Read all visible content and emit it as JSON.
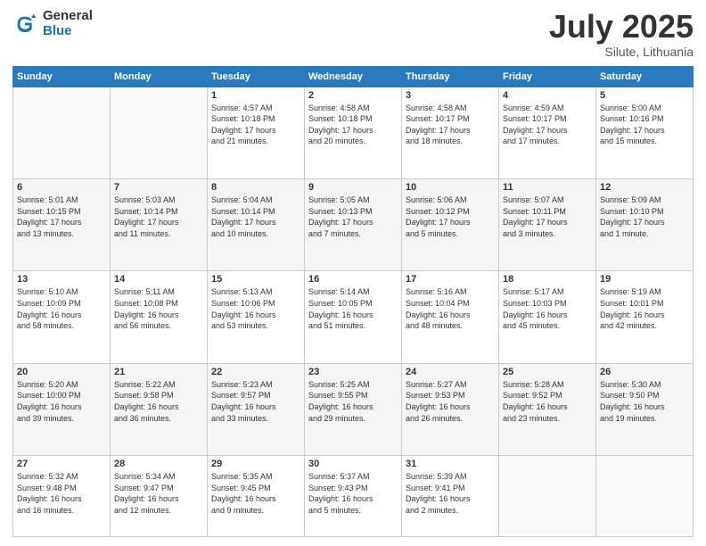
{
  "header": {
    "logo_general": "General",
    "logo_blue": "Blue",
    "month": "July 2025",
    "location": "Silute, Lithuania"
  },
  "days_of_week": [
    "Sunday",
    "Monday",
    "Tuesday",
    "Wednesday",
    "Thursday",
    "Friday",
    "Saturday"
  ],
  "weeks": [
    [
      {
        "num": "",
        "info": ""
      },
      {
        "num": "",
        "info": ""
      },
      {
        "num": "1",
        "info": "Sunrise: 4:57 AM\nSunset: 10:18 PM\nDaylight: 17 hours\nand 21 minutes."
      },
      {
        "num": "2",
        "info": "Sunrise: 4:58 AM\nSunset: 10:18 PM\nDaylight: 17 hours\nand 20 minutes."
      },
      {
        "num": "3",
        "info": "Sunrise: 4:58 AM\nSunset: 10:17 PM\nDaylight: 17 hours\nand 18 minutes."
      },
      {
        "num": "4",
        "info": "Sunrise: 4:59 AM\nSunset: 10:17 PM\nDaylight: 17 hours\nand 17 minutes."
      },
      {
        "num": "5",
        "info": "Sunrise: 5:00 AM\nSunset: 10:16 PM\nDaylight: 17 hours\nand 15 minutes."
      }
    ],
    [
      {
        "num": "6",
        "info": "Sunrise: 5:01 AM\nSunset: 10:15 PM\nDaylight: 17 hours\nand 13 minutes."
      },
      {
        "num": "7",
        "info": "Sunrise: 5:03 AM\nSunset: 10:14 PM\nDaylight: 17 hours\nand 11 minutes."
      },
      {
        "num": "8",
        "info": "Sunrise: 5:04 AM\nSunset: 10:14 PM\nDaylight: 17 hours\nand 10 minutes."
      },
      {
        "num": "9",
        "info": "Sunrise: 5:05 AM\nSunset: 10:13 PM\nDaylight: 17 hours\nand 7 minutes."
      },
      {
        "num": "10",
        "info": "Sunrise: 5:06 AM\nSunset: 10:12 PM\nDaylight: 17 hours\nand 5 minutes."
      },
      {
        "num": "11",
        "info": "Sunrise: 5:07 AM\nSunset: 10:11 PM\nDaylight: 17 hours\nand 3 minutes."
      },
      {
        "num": "12",
        "info": "Sunrise: 5:09 AM\nSunset: 10:10 PM\nDaylight: 17 hours\nand 1 minute."
      }
    ],
    [
      {
        "num": "13",
        "info": "Sunrise: 5:10 AM\nSunset: 10:09 PM\nDaylight: 16 hours\nand 58 minutes."
      },
      {
        "num": "14",
        "info": "Sunrise: 5:11 AM\nSunset: 10:08 PM\nDaylight: 16 hours\nand 56 minutes."
      },
      {
        "num": "15",
        "info": "Sunrise: 5:13 AM\nSunset: 10:06 PM\nDaylight: 16 hours\nand 53 minutes."
      },
      {
        "num": "16",
        "info": "Sunrise: 5:14 AM\nSunset: 10:05 PM\nDaylight: 16 hours\nand 51 minutes."
      },
      {
        "num": "17",
        "info": "Sunrise: 5:16 AM\nSunset: 10:04 PM\nDaylight: 16 hours\nand 48 minutes."
      },
      {
        "num": "18",
        "info": "Sunrise: 5:17 AM\nSunset: 10:03 PM\nDaylight: 16 hours\nand 45 minutes."
      },
      {
        "num": "19",
        "info": "Sunrise: 5:19 AM\nSunset: 10:01 PM\nDaylight: 16 hours\nand 42 minutes."
      }
    ],
    [
      {
        "num": "20",
        "info": "Sunrise: 5:20 AM\nSunset: 10:00 PM\nDaylight: 16 hours\nand 39 minutes."
      },
      {
        "num": "21",
        "info": "Sunrise: 5:22 AM\nSunset: 9:58 PM\nDaylight: 16 hours\nand 36 minutes."
      },
      {
        "num": "22",
        "info": "Sunrise: 5:23 AM\nSunset: 9:57 PM\nDaylight: 16 hours\nand 33 minutes."
      },
      {
        "num": "23",
        "info": "Sunrise: 5:25 AM\nSunset: 9:55 PM\nDaylight: 16 hours\nand 29 minutes."
      },
      {
        "num": "24",
        "info": "Sunrise: 5:27 AM\nSunset: 9:53 PM\nDaylight: 16 hours\nand 26 minutes."
      },
      {
        "num": "25",
        "info": "Sunrise: 5:28 AM\nSunset: 9:52 PM\nDaylight: 16 hours\nand 23 minutes."
      },
      {
        "num": "26",
        "info": "Sunrise: 5:30 AM\nSunset: 9:50 PM\nDaylight: 16 hours\nand 19 minutes."
      }
    ],
    [
      {
        "num": "27",
        "info": "Sunrise: 5:32 AM\nSunset: 9:48 PM\nDaylight: 16 hours\nand 16 minutes."
      },
      {
        "num": "28",
        "info": "Sunrise: 5:34 AM\nSunset: 9:47 PM\nDaylight: 16 hours\nand 12 minutes."
      },
      {
        "num": "29",
        "info": "Sunrise: 5:35 AM\nSunset: 9:45 PM\nDaylight: 16 hours\nand 9 minutes."
      },
      {
        "num": "30",
        "info": "Sunrise: 5:37 AM\nSunset: 9:43 PM\nDaylight: 16 hours\nand 5 minutes."
      },
      {
        "num": "31",
        "info": "Sunrise: 5:39 AM\nSunset: 9:41 PM\nDaylight: 16 hours\nand 2 minutes."
      },
      {
        "num": "",
        "info": ""
      },
      {
        "num": "",
        "info": ""
      }
    ]
  ]
}
